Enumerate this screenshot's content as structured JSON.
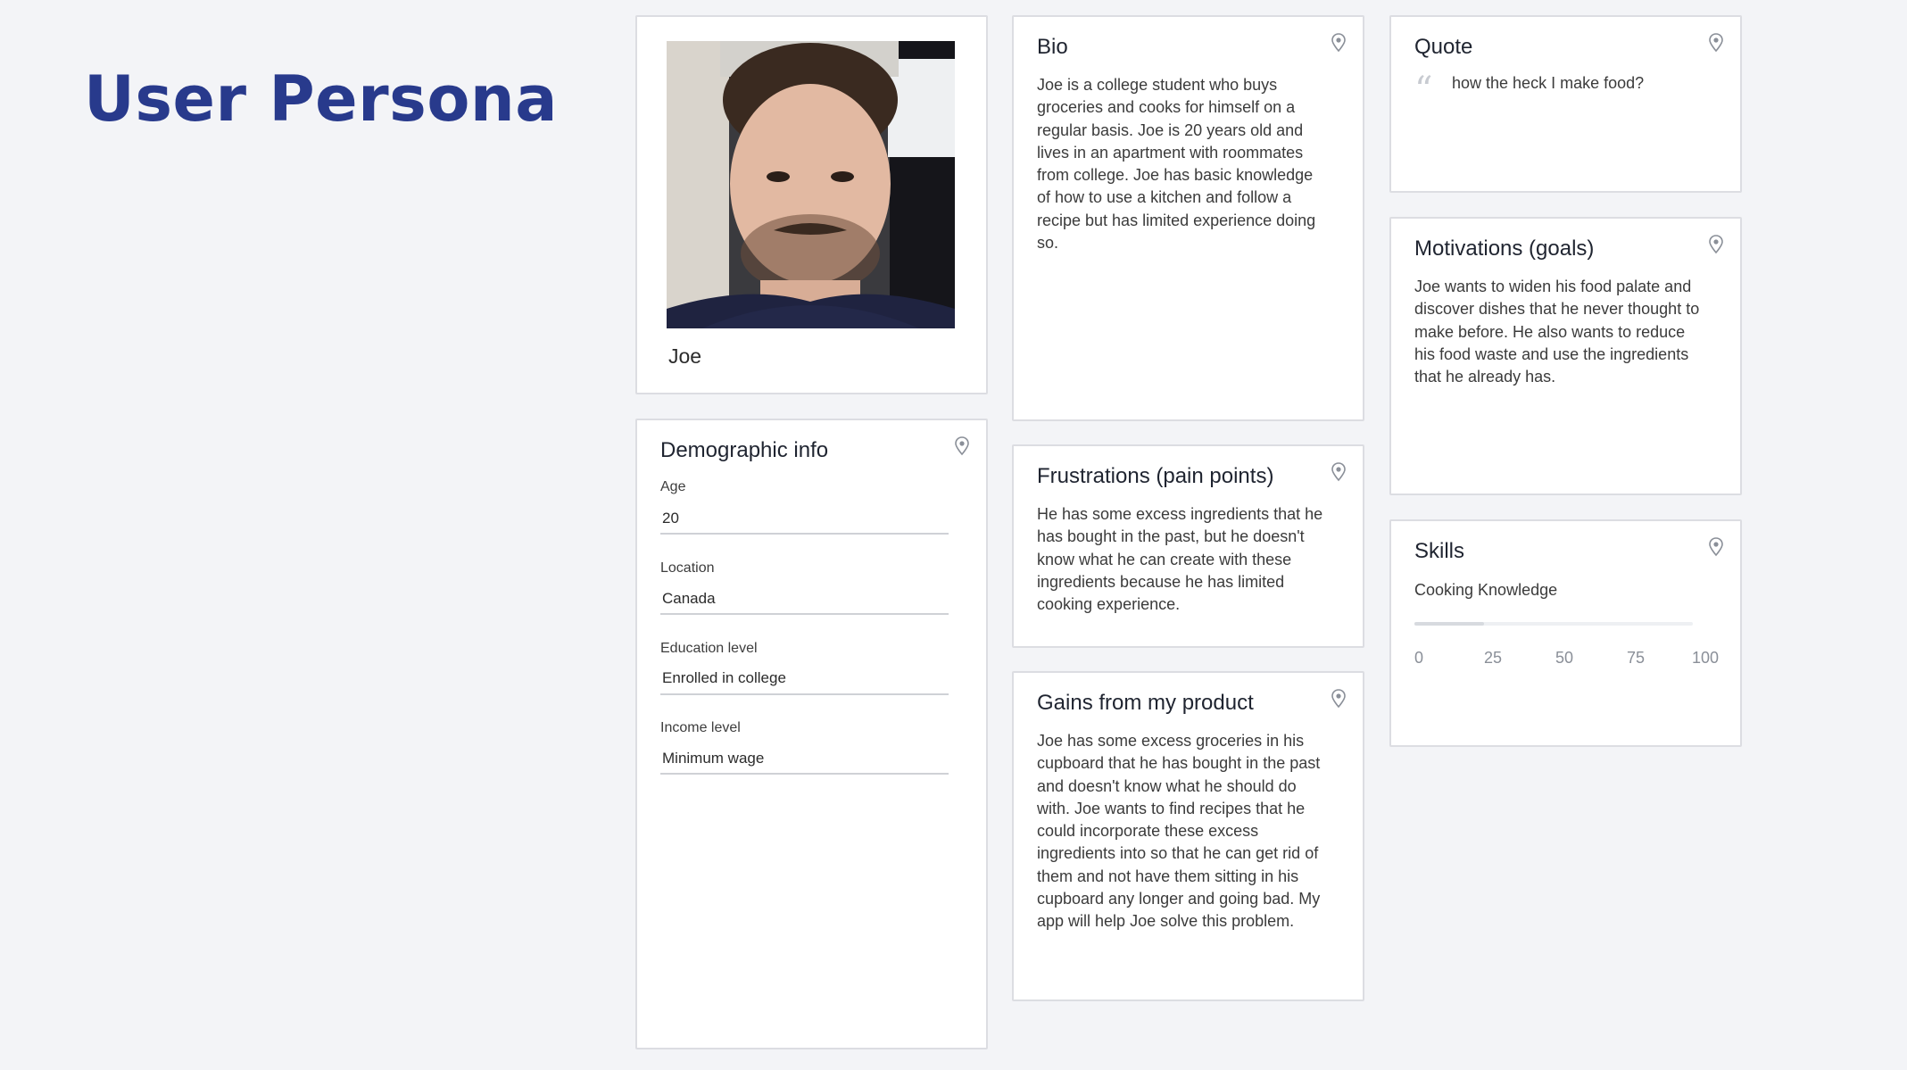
{
  "page": {
    "title": "User Persona"
  },
  "persona": {
    "name": "Joe"
  },
  "bio": {
    "title": "Bio",
    "text": "Joe is a college student who buys groceries and cooks for himself on a regular basis. Joe is 20 years old and lives in an apartment with roommates from college. Joe has basic knowledge of how to use a kitchen and follow a recipe but has limited experience doing so."
  },
  "quote": {
    "title": "Quote",
    "text": "how the heck I make food?"
  },
  "motivations": {
    "title": "Motivations (goals)",
    "text": "Joe wants to widen his food palate and discover dishes that he never thought to make before. He also wants to reduce his food waste and use the ingredients that he already has."
  },
  "demographic": {
    "title": "Demographic info",
    "fields": [
      {
        "label": "Age",
        "value": "20"
      },
      {
        "label": "Location",
        "value": "Canada"
      },
      {
        "label": "Education level",
        "value": "Enrolled in college"
      },
      {
        "label": "Income level",
        "value": "Minimum wage"
      }
    ]
  },
  "frustrations": {
    "title": "Frustrations (pain points)",
    "text": "He has some excess ingredients that he has bought in the past, but he doesn't know what he can create with these ingredients because he has limited cooking experience."
  },
  "gains": {
    "title": "Gains from my product",
    "text": "Joe has some excess groceries in his cupboard that he has bought in the past and doesn't know what he should do with. Joe wants to find recipes that he could incorporate these excess ingredients into so that he can get rid of them and not have them sitting in his cupboard any longer and going bad. My app will help Joe solve this problem."
  },
  "skills": {
    "title": "Skills",
    "items": [
      {
        "label": "Cooking Knowledge",
        "value": 25
      }
    ],
    "scale": [
      "0",
      "25",
      "50",
      "75",
      "100"
    ]
  },
  "colors": {
    "title": "#283a8c",
    "background": "#f3f4f7",
    "card_border": "#dcdde2"
  },
  "icons": {
    "pin": "pin-icon",
    "quote": "quote-icon"
  }
}
